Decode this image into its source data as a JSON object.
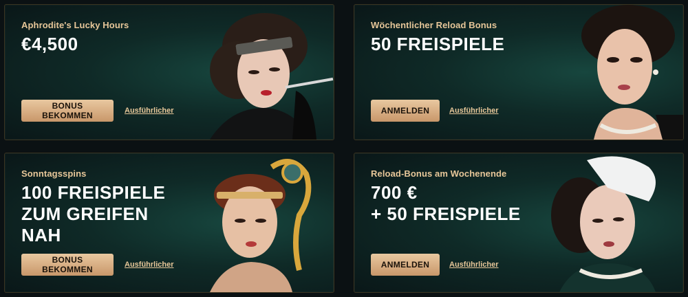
{
  "cards": [
    {
      "subtitle": "Aphrodite's Lucky Hours",
      "headline": "€4,500",
      "button": "BONUS BEKOMMEN",
      "more": "Ausführlicher",
      "image": "flapper-woman-with-cigarette-holder"
    },
    {
      "subtitle": "Wöchentlicher Reload Bonus",
      "headline": "50 FREISPIELE",
      "button": "ANMELDEN",
      "more": "Ausführlicher",
      "image": "woman-with-pearl-necklace"
    },
    {
      "subtitle": "Sonntagsspins",
      "headline_line1": "100 FREISPIELE",
      "headline_line2": "ZUM GREIFEN",
      "headline_line3": "NAH",
      "button": "BONUS BEKOMMEN",
      "more": "Ausführlicher",
      "image": "woman-with-peacock-feather-headpiece"
    },
    {
      "subtitle": "Reload-Bonus am Wochenende",
      "headline_line1": "700 €",
      "headline_line2": "+ 50 FREISPIELE",
      "button": "ANMELDEN",
      "more": "Ausführlicher",
      "image": "woman-with-feather-fascinator"
    }
  ],
  "colors": {
    "background": "#0b1113",
    "card": "#0f2a27",
    "gold": "#e7c799",
    "button": "#d6ab7f"
  }
}
